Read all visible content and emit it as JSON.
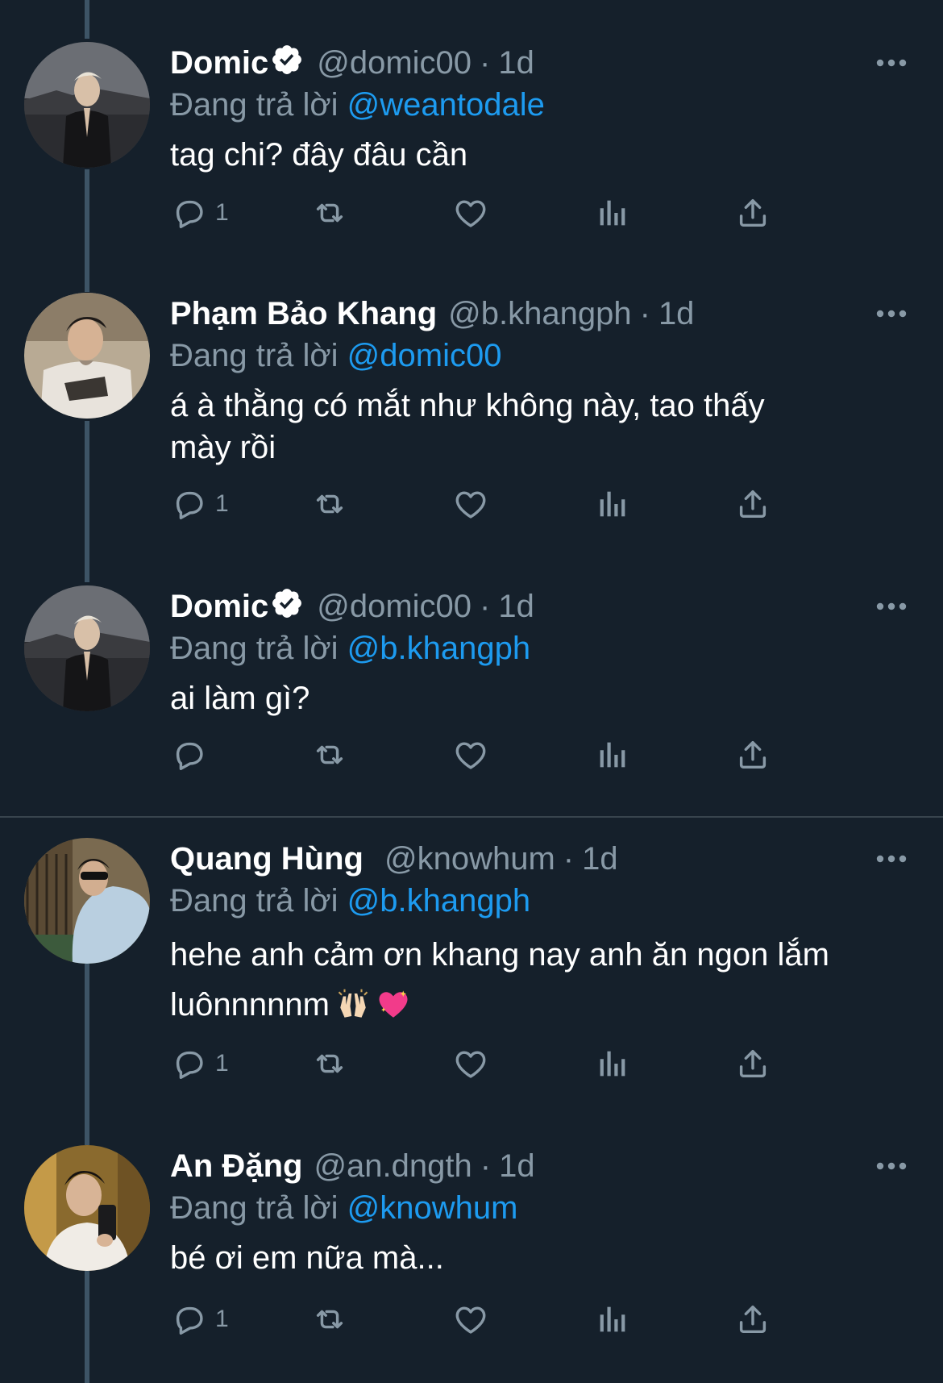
{
  "tweets": [
    {
      "name": "Domic",
      "verified": true,
      "handle": "@domic00",
      "sep": "·",
      "time": "1d",
      "replying_prefix": "Đang trả lời",
      "replying_to": "@weantodale",
      "text": "tag chi? đây đâu cần",
      "reply_count": "1"
    },
    {
      "name": "Phạm Bảo Khang",
      "verified": false,
      "handle": "@b.khangph",
      "sep": "·",
      "time": "1d",
      "replying_prefix": "Đang trả lời",
      "replying_to": "@domic00",
      "text": "á à thằng có mắt như không này, tao thấy\nmày rồi",
      "reply_count": "1"
    },
    {
      "name": "Domic",
      "verified": true,
      "handle": "@domic00",
      "sep": "·",
      "time": "1d",
      "replying_prefix": "Đang trả lời",
      "replying_to": "@b.khangph",
      "text": "ai làm gì?",
      "reply_count": ""
    },
    {
      "name": "Quang Hùng",
      "verified": false,
      "handle": "@knowhum",
      "sep": "·",
      "time": "1d",
      "replying_prefix": "Đang trả lời",
      "replying_to": "@b.khangph",
      "text": "hehe anh cảm ơn khang nay anh ăn ngon lắm\nluônnnnnm",
      "emojis": [
        "raising-hands-emoji",
        "sparkling-heart-emoji"
      ],
      "reply_count": "1"
    },
    {
      "name": "An Đặng",
      "verified": false,
      "handle": "@an.dngth",
      "sep": "·",
      "time": "1d",
      "replying_prefix": "Đang trả lời",
      "replying_to": "@knowhum",
      "text": "bé ơi em nữa mà...",
      "reply_count": "1"
    }
  ],
  "colors": {
    "background": "#15202b",
    "secondary_text": "#8899a6",
    "link": "#1d9bf0",
    "thread_line": "#3d5466"
  },
  "icons": [
    "reply-icon",
    "retweet-icon",
    "like-icon",
    "views-icon",
    "share-icon",
    "more-icon",
    "verified-badge-icon"
  ]
}
